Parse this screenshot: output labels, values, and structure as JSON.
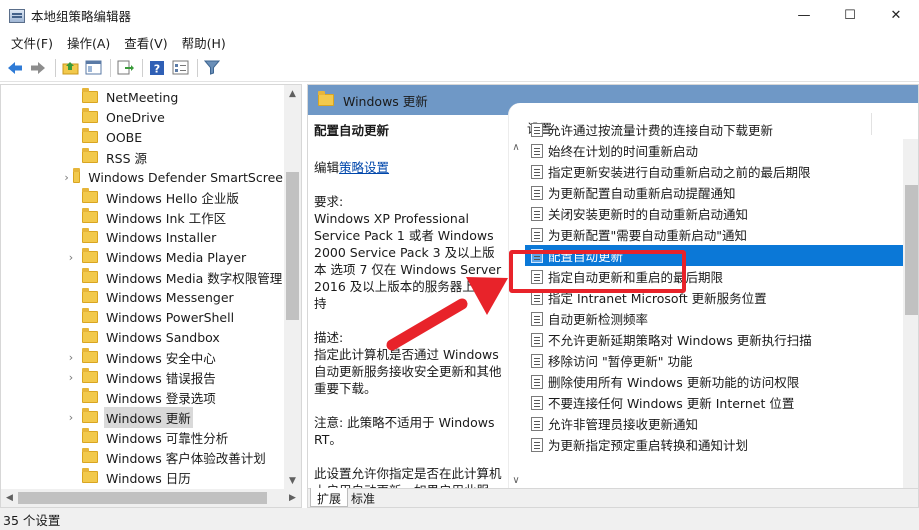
{
  "window": {
    "title": "本地组策略编辑器",
    "minimize": "—",
    "maximize": "☐",
    "close": "✕"
  },
  "menu": [
    "文件(F)",
    "操作(A)",
    "查看(V)",
    "帮助(H)"
  ],
  "tree": {
    "items": [
      {
        "label": "NetMeeting",
        "expandable": false
      },
      {
        "label": "OneDrive",
        "expandable": false
      },
      {
        "label": "OOBE",
        "expandable": false
      },
      {
        "label": "RSS 源",
        "expandable": false
      },
      {
        "label": "Windows Defender SmartScree",
        "expandable": true
      },
      {
        "label": "Windows Hello 企业版",
        "expandable": false
      },
      {
        "label": "Windows Ink 工作区",
        "expandable": false
      },
      {
        "label": "Windows Installer",
        "expandable": false
      },
      {
        "label": "Windows Media Player",
        "expandable": true
      },
      {
        "label": "Windows Media 数字权限管理",
        "expandable": false
      },
      {
        "label": "Windows Messenger",
        "expandable": false
      },
      {
        "label": "Windows PowerShell",
        "expandable": false
      },
      {
        "label": "Windows Sandbox",
        "expandable": false
      },
      {
        "label": "Windows 安全中心",
        "expandable": true
      },
      {
        "label": "Windows 错误报告",
        "expandable": true
      },
      {
        "label": "Windows 登录选项",
        "expandable": false
      },
      {
        "label": "Windows 更新",
        "expandable": true,
        "selected": true
      },
      {
        "label": "Windows 可靠性分析",
        "expandable": false
      },
      {
        "label": "Windows 客户体验改善计划",
        "expandable": false
      },
      {
        "label": "Windows 日历",
        "expandable": false
      }
    ]
  },
  "right_header": "Windows 更新",
  "description": {
    "title": "配置自动更新",
    "edit_prefix": "编辑",
    "edit_link": "策略设置",
    "requirements_label": "要求:",
    "requirements_text": "Windows XP Professional Service Pack 1 或者 Windows 2000 Service Pack 3 及以上版本 选项 7 仅在 Windows Server 2016 及以上版本的服务器上受支持",
    "desc_label": "描述:",
    "desc_text": "指定此计算机是否通过 Windows 自动更新服务接收安全更新和其他重要下载。",
    "note_text": "注意: 此策略不适用于 Windows RT。",
    "more_text": "此设置允许你指定是否在此计算机上启用自动更新。如果启用此服"
  },
  "list": {
    "header": "设置",
    "items": [
      "允许通过按流量计费的连接自动下载更新",
      "始终在计划的时间重新启动",
      "指定更新安装进行自动重新启动之前的最后期限",
      "为更新配置自动重新启动提醒通知",
      "关闭安装更新时的自动重新启动通知",
      "为更新配置\"需要自动重新启动\"通知",
      "配置自动更新",
      "指定自动更新和重启的最后期限",
      "指定 Intranet Microsoft 更新服务位置",
      "自动更新检测频率",
      "不允许更新延期策略对 Windows 更新执行扫描",
      "移除访问 \"暂停更新\" 功能",
      "删除使用所有 Windows 更新功能的访问权限",
      "不要连接任何 Windows 更新 Internet 位置",
      "允许非管理员接收更新通知",
      "为更新指定预定重启转换和通知计划"
    ],
    "selected_index": 6
  },
  "tabs": [
    "扩展",
    "标准"
  ],
  "active_tab": 0,
  "status": "35 个设置",
  "colors": {
    "header_blue": "#6f98c6",
    "selection_blue": "#0b78d7",
    "annotation_red": "#e8232a",
    "link_blue": "#0047ab"
  }
}
